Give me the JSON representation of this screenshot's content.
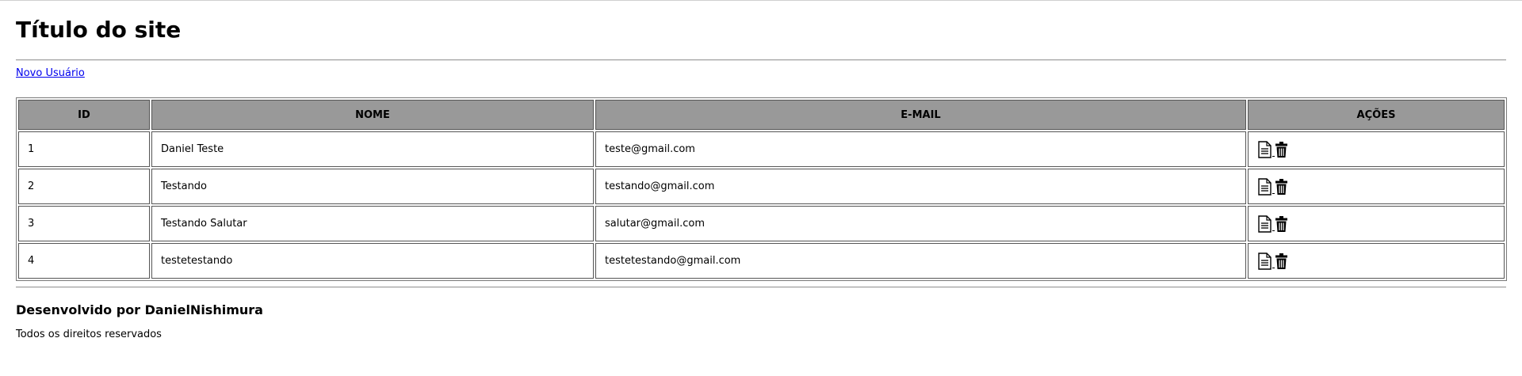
{
  "header": {
    "title": "Título do site"
  },
  "nav": {
    "new_user_link": "Novo Usuário"
  },
  "table": {
    "columns": [
      "ID",
      "NOME",
      "E-MAIL",
      "AÇÕES"
    ],
    "rows": [
      {
        "id": "1",
        "nome": "Daniel Teste",
        "email": "teste@gmail.com",
        "actions": [
          "document-icon",
          "trash-icon"
        ]
      },
      {
        "id": "2",
        "nome": "Testando",
        "email": "testando@gmail.com",
        "actions": [
          "document-icon",
          "trash-icon"
        ]
      },
      {
        "id": "3",
        "nome": "Testando Salutar",
        "email": "salutar@gmail.com",
        "actions": [
          "document-icon",
          "trash-icon"
        ]
      },
      {
        "id": "4",
        "nome": "testetestando",
        "email": "testetestando@gmail.com",
        "actions": [
          "document-icon",
          "trash-icon"
        ]
      }
    ],
    "header_bg": "#999999"
  },
  "footer": {
    "developer": "Desenvolvido por DanielNishimura",
    "rights": "Todos os direitos reservados"
  }
}
